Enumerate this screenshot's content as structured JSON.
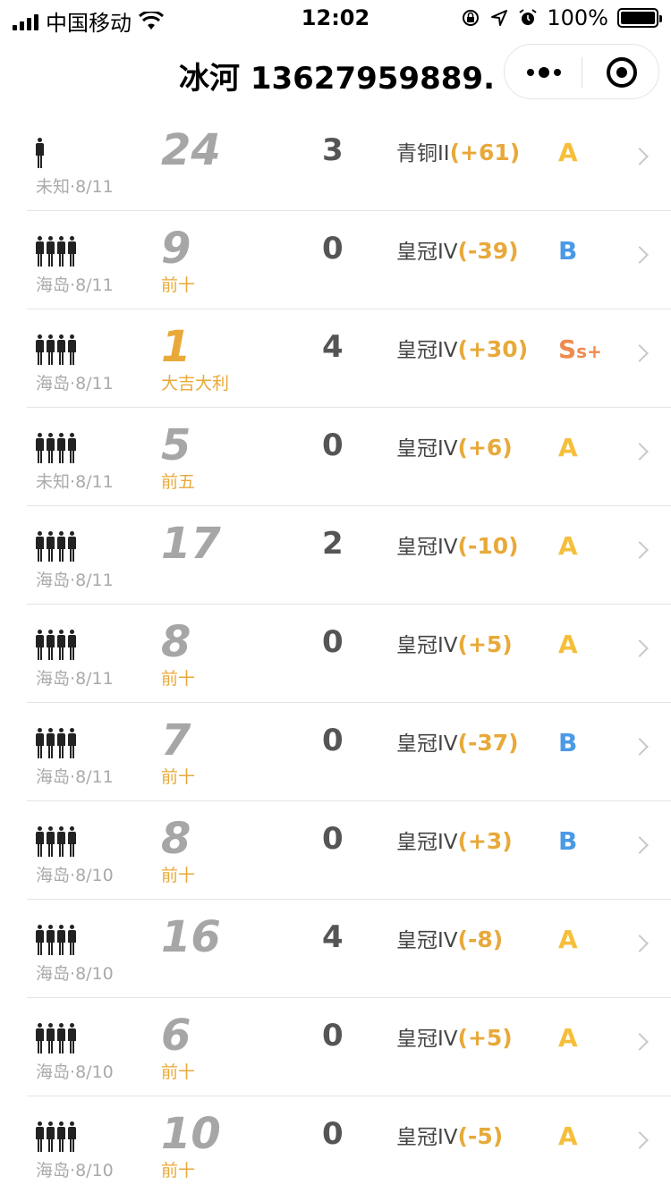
{
  "status_bar": {
    "carrier": "中国移动",
    "time": "12:02",
    "battery": "100%",
    "battery_level": 1.0
  },
  "nav": {
    "title": "冰河  13627959889...",
    "more_icon": "more-dots-icon",
    "close_icon": "target-circle-icon"
  },
  "colors": {
    "gold": "#e8a93a",
    "grade_A": "#f5bf3c",
    "grade_B": "#4a9ae6",
    "grade_S": "#ef8a4f",
    "rank_gray": "#a6a6a6"
  },
  "matches": [
    {
      "mode_size": 1,
      "map": "未知",
      "date": "8/11",
      "rank": "24",
      "rank_label": "",
      "kills": "3",
      "tier": "青铜II",
      "change": "(+61)",
      "grade": "A",
      "grade_suffix": ""
    },
    {
      "mode_size": 4,
      "map": "海岛",
      "date": "8/11",
      "rank": "9",
      "rank_label": "前十",
      "kills": "0",
      "tier": "皇冠IV",
      "change": "(-39)",
      "grade": "B",
      "grade_suffix": ""
    },
    {
      "mode_size": 4,
      "map": "海岛",
      "date": "8/11",
      "rank": "1",
      "rank_label": "大吉大利",
      "kills": "4",
      "tier": "皇冠IV",
      "change": "(+30)",
      "grade": "S",
      "grade_suffix": "s+"
    },
    {
      "mode_size": 4,
      "map": "未知",
      "date": "8/11",
      "rank": "5",
      "rank_label": "前五",
      "kills": "0",
      "tier": "皇冠IV",
      "change": "(+6)",
      "grade": "A",
      "grade_suffix": ""
    },
    {
      "mode_size": 4,
      "map": "海岛",
      "date": "8/11",
      "rank": "17",
      "rank_label": "",
      "kills": "2",
      "tier": "皇冠IV",
      "change": "(-10)",
      "grade": "A",
      "grade_suffix": ""
    },
    {
      "mode_size": 4,
      "map": "海岛",
      "date": "8/11",
      "rank": "8",
      "rank_label": "前十",
      "kills": "0",
      "tier": "皇冠IV",
      "change": "(+5)",
      "grade": "A",
      "grade_suffix": ""
    },
    {
      "mode_size": 4,
      "map": "海岛",
      "date": "8/11",
      "rank": "7",
      "rank_label": "前十",
      "kills": "0",
      "tier": "皇冠IV",
      "change": "(-37)",
      "grade": "B",
      "grade_suffix": ""
    },
    {
      "mode_size": 4,
      "map": "海岛",
      "date": "8/10",
      "rank": "8",
      "rank_label": "前十",
      "kills": "0",
      "tier": "皇冠IV",
      "change": "(+3)",
      "grade": "B",
      "grade_suffix": ""
    },
    {
      "mode_size": 4,
      "map": "海岛",
      "date": "8/10",
      "rank": "16",
      "rank_label": "",
      "kills": "4",
      "tier": "皇冠IV",
      "change": "(-8)",
      "grade": "A",
      "grade_suffix": ""
    },
    {
      "mode_size": 4,
      "map": "海岛",
      "date": "8/10",
      "rank": "6",
      "rank_label": "前十",
      "kills": "0",
      "tier": "皇冠IV",
      "change": "(+5)",
      "grade": "A",
      "grade_suffix": ""
    },
    {
      "mode_size": 4,
      "map": "海岛",
      "date": "8/10",
      "rank": "10",
      "rank_label": "前十",
      "kills": "0",
      "tier": "皇冠IV",
      "change": "(-5)",
      "grade": "A",
      "grade_suffix": ""
    }
  ]
}
